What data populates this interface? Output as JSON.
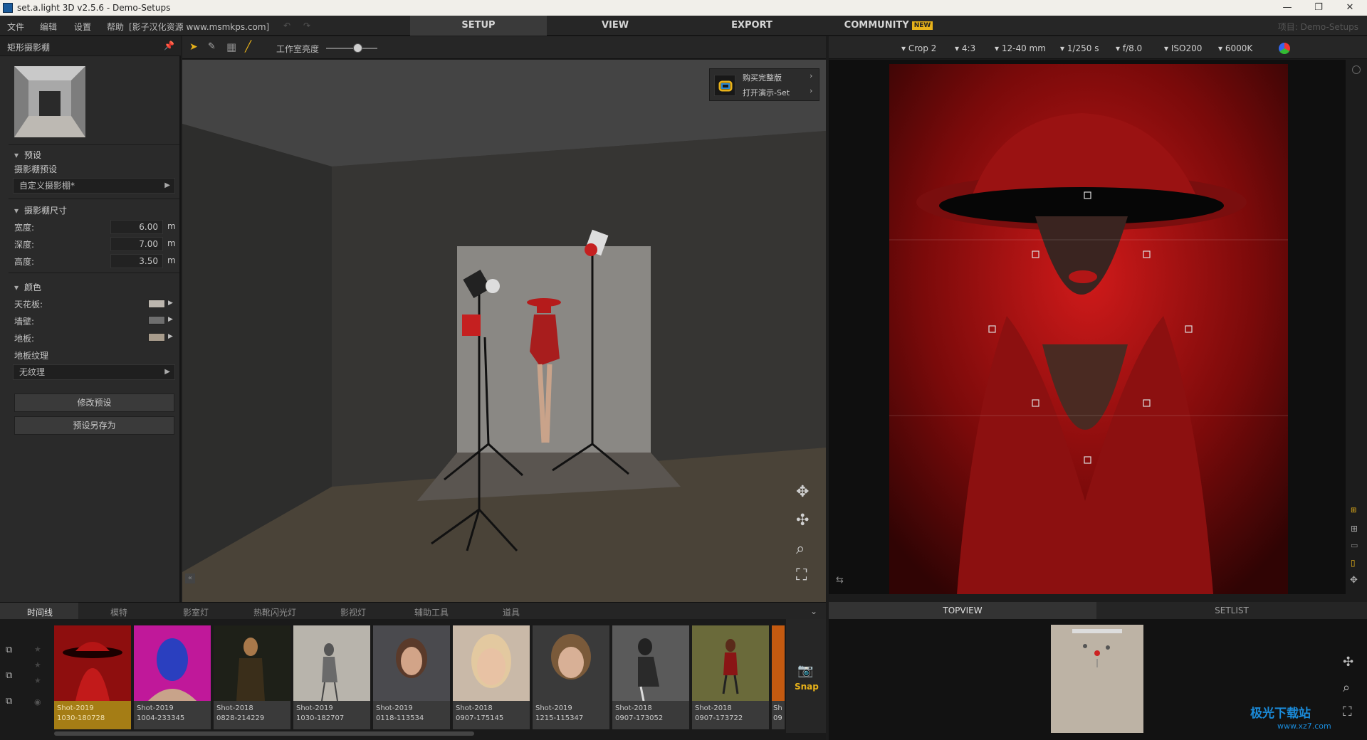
{
  "window": {
    "title": "set.a.light 3D v2.5.6 - Demo-Setups"
  },
  "menu": {
    "items": [
      "文件",
      "编辑",
      "设置",
      "帮助"
    ],
    "watermark": "[影子汉化资源 www.msmkps.com]"
  },
  "tabs": {
    "setup": "SETUP",
    "view": "VIEW",
    "export": "EXPORT",
    "community": "COMMUNITY",
    "new_badge": "NEW"
  },
  "project_label": "项目: Demo-Setups",
  "left": {
    "panel_title": "矩形摄影棚",
    "preset_section": "预设",
    "preset_label": "摄影棚预设",
    "preset_value": "自定义摄影棚*",
    "size_section": "摄影棚尺寸",
    "width_label": "宽度:",
    "width_value": "6.00",
    "depth_label": "深度:",
    "depth_value": "7.00",
    "height_label": "高度:",
    "height_value": "3.50",
    "unit": "m",
    "color_section": "颜色",
    "ceiling_label": "天花板:",
    "wall_label": "墙壁:",
    "floor_label": "地板:",
    "texture_label": "地板纹理",
    "texture_value": "无纹理",
    "modify_button": "修改预设",
    "saveas_button": "预设另存为",
    "colors": {
      "ceiling": "#bcb6ae",
      "wall": "#6e6e6e",
      "floor": "#a89c8c"
    }
  },
  "viewtoolbar": {
    "brightness_label": "工作室亮度"
  },
  "overlay": {
    "buy": "购买完整版",
    "open_demo": "打开演示-Set"
  },
  "camera": {
    "crop": "Crop 2",
    "ratio": "4:3",
    "lens": "12-40 mm",
    "shutter": "1/250 s",
    "aperture": "f/8.0",
    "iso": "ISO200",
    "wb": "6000K"
  },
  "bottom_tabs": [
    "时间线",
    "模特",
    "影室灯",
    "热靴闪光灯",
    "影视灯",
    "辅助工具",
    "道具"
  ],
  "snap_label": "Snap",
  "thumbnails": [
    {
      "l1": "Shot-2019",
      "l2": "1030-180728"
    },
    {
      "l1": "Shot-2019",
      "l2": "1004-233345"
    },
    {
      "l1": "Shot-2018",
      "l2": "0828-214229"
    },
    {
      "l1": "Shot-2019",
      "l2": "1030-182707"
    },
    {
      "l1": "Shot-2019",
      "l2": "0118-113534"
    },
    {
      "l1": "Shot-2018",
      "l2": "0907-175145"
    },
    {
      "l1": "Shot-2019",
      "l2": "1215-115347"
    },
    {
      "l1": "Shot-2018",
      "l2": "0907-173052"
    },
    {
      "l1": "Shot-2018",
      "l2": "0907-173722"
    },
    {
      "l1": "Sh",
      "l2": "09"
    }
  ],
  "right_tabs": {
    "topview": "TOPVIEW",
    "setlist": "SETLIST"
  },
  "watermark": {
    "text": "极光下载站",
    "url": "www.xz7.com"
  }
}
